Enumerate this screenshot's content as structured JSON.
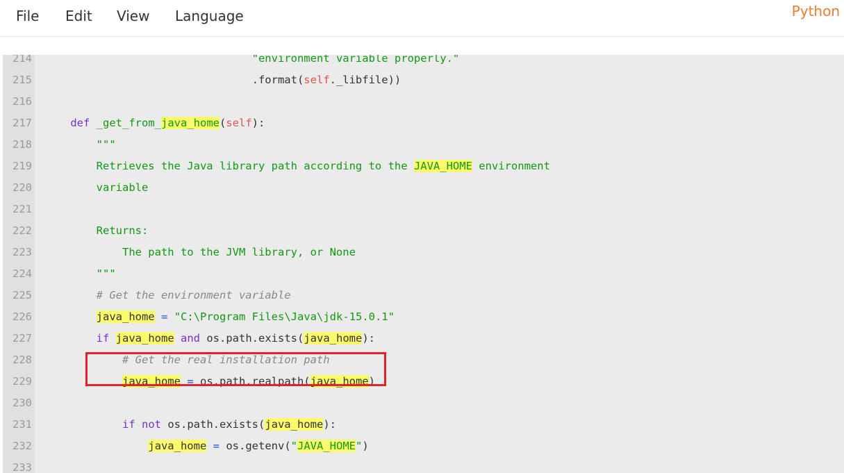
{
  "menu": {
    "file": "File",
    "edit": "Edit",
    "view": "View",
    "language": "Language"
  },
  "language_indicator": "Python",
  "accent_color": "#f07c31",
  "annotation_color": "#e2232a",
  "code": {
    "lines": [
      {
        "n": "214",
        "text": "                                \"environment variable properly.\""
      },
      {
        "n": "215",
        "text": "                                .format(self._libfile))"
      },
      {
        "n": "216",
        "text": ""
      },
      {
        "n": "217",
        "text": "    def _get_from_java_home(self):"
      },
      {
        "n": "218",
        "text": "        \"\"\""
      },
      {
        "n": "219",
        "text": "        Retrieves the Java library path according to the JAVA_HOME environment"
      },
      {
        "n": "220",
        "text": "        variable"
      },
      {
        "n": "221",
        "text": ""
      },
      {
        "n": "222",
        "text": "        Returns:"
      },
      {
        "n": "223",
        "text": "            The path to the JVM library, or None"
      },
      {
        "n": "224",
        "text": "        \"\"\""
      },
      {
        "n": "225",
        "text": "        # Get the environment variable"
      },
      {
        "n": "226",
        "text": "        java_home = \"C:\\Program Files\\Java\\jdk-15.0.1\""
      },
      {
        "n": "227",
        "text": "        if java_home and os.path.exists(java_home):"
      },
      {
        "n": "228",
        "text": "            # Get the real installation path"
      },
      {
        "n": "229",
        "text": "            java_home = os.path.realpath(java_home)"
      },
      {
        "n": "230",
        "text": ""
      },
      {
        "n": "231",
        "text": "            if not os.path.exists(java_home):"
      },
      {
        "n": "232",
        "text": "                java_home = os.getenv(\"JAVA_HOME\")"
      },
      {
        "n": "233",
        "text": ""
      }
    ]
  }
}
